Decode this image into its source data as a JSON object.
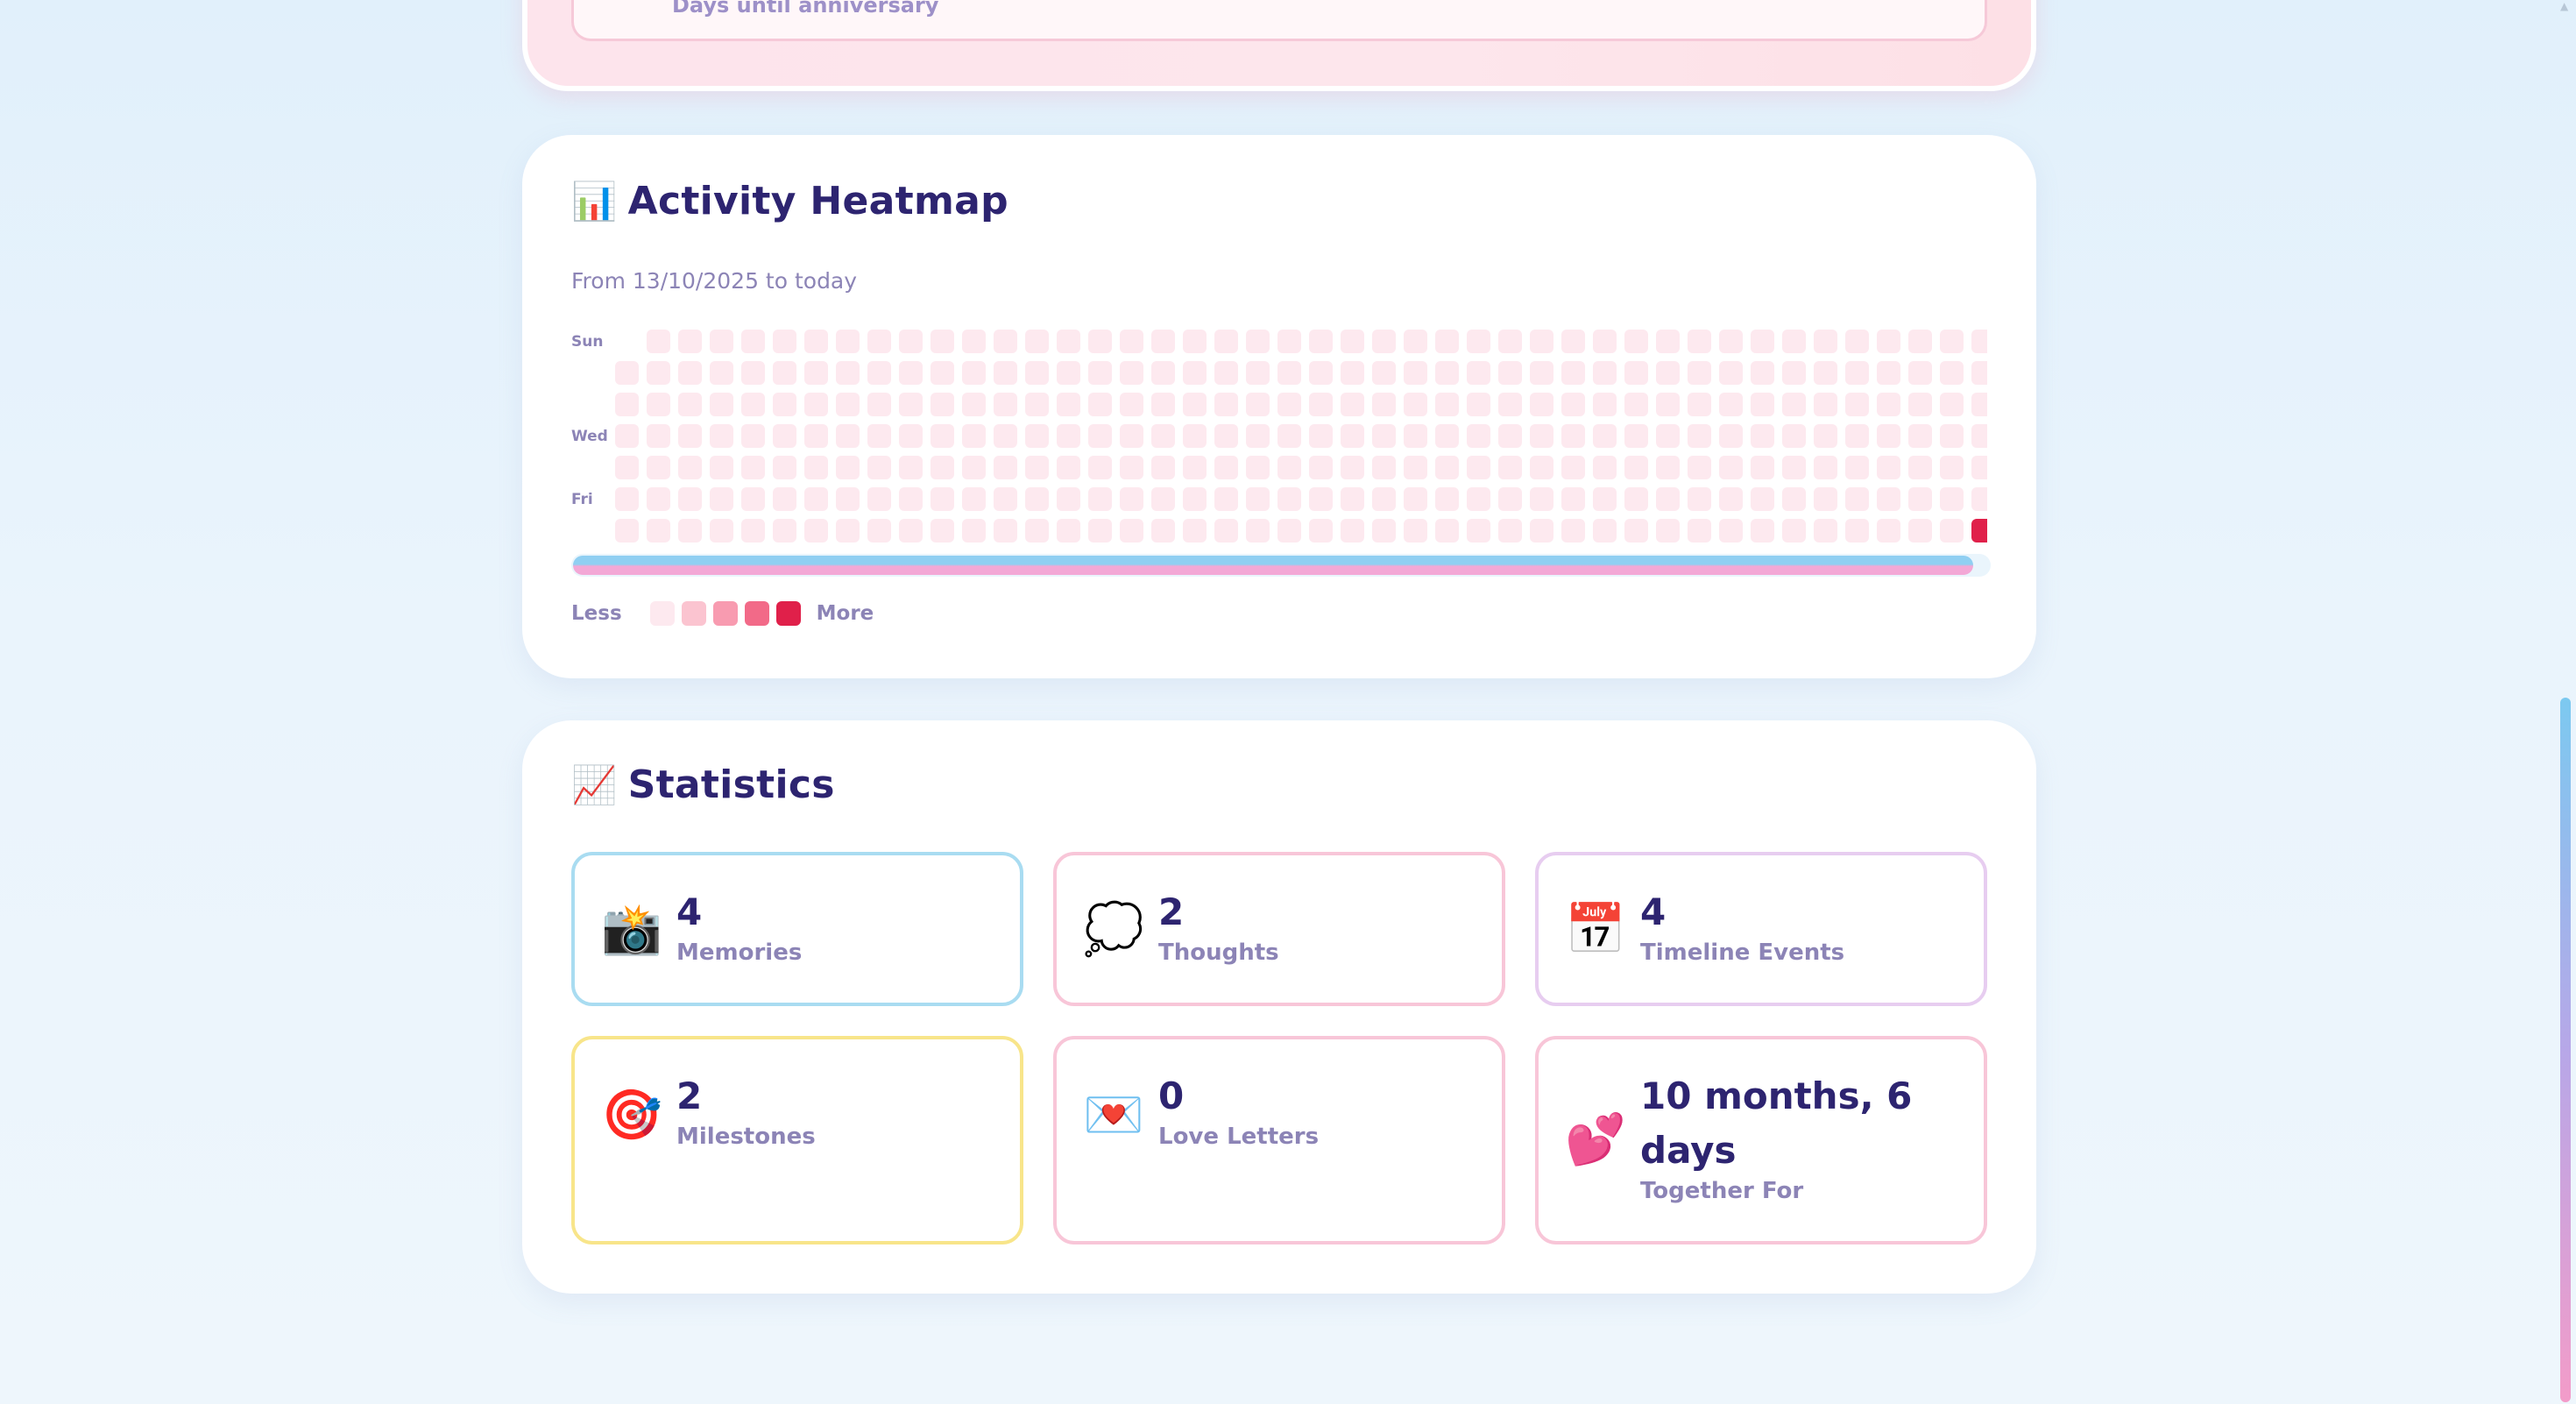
{
  "top_card": {
    "partial_text": "Days until anniversary"
  },
  "heatmap": {
    "icon": "bar-chart-icon",
    "emoji": "📊",
    "title": "Activity Heatmap",
    "subtitle": "From 13/10/2025 to today",
    "day_labels": {
      "sun": "Sun",
      "wed": "Wed",
      "fri": "Fri"
    },
    "legend": {
      "less": "Less",
      "more": "More",
      "colors": [
        "#fde9ef",
        "#fbc4d0",
        "#f89bb0",
        "#f26a88",
        "#e0204a"
      ]
    },
    "active_cell": {
      "row": 6,
      "level": 4
    }
  },
  "statistics": {
    "icon": "chart-increasing-icon",
    "emoji": "📈",
    "title": "Statistics",
    "tiles": [
      {
        "icon": "camera-flash-icon",
        "emoji": "📸",
        "value": "4",
        "label": "Memories",
        "border": "#a9dcf1"
      },
      {
        "icon": "thought-bubble-icon",
        "emoji": "💭",
        "value": "2",
        "label": "Thoughts",
        "border": "#f8c6d8"
      },
      {
        "icon": "calendar-icon",
        "emoji": "📅",
        "value": "4",
        "label": "Timeline Events",
        "border": "#e7cdf0"
      },
      {
        "icon": "target-icon",
        "emoji": "🎯",
        "value": "2",
        "label": "Milestones",
        "border": "#f8e58a"
      },
      {
        "icon": "love-letter-icon",
        "emoji": "💌",
        "value": "0",
        "label": "Love Letters",
        "border": "#f8c6d8"
      },
      {
        "icon": "two-hearts-icon",
        "emoji": "💕",
        "value": "10 months, 6 days",
        "label": "Together For",
        "border": "#f8c6d8"
      }
    ]
  }
}
